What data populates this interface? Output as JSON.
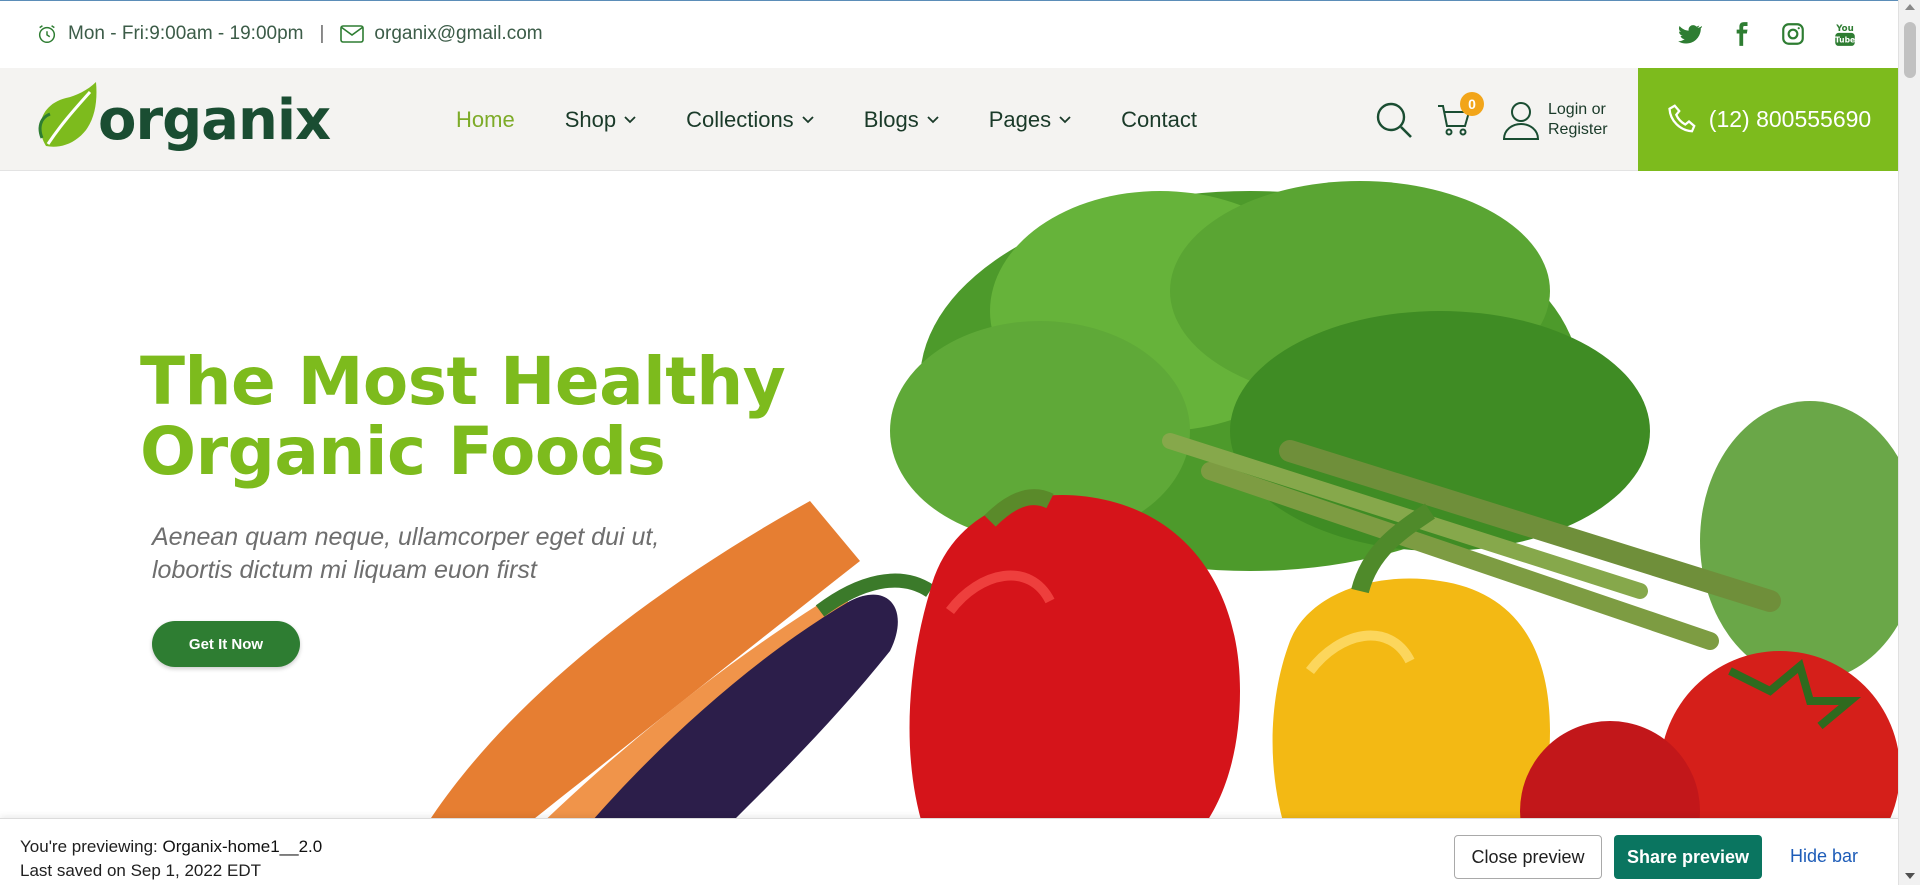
{
  "topbar": {
    "hours": "Mon - Fri:9:00am - 19:00pm",
    "separator": "|",
    "email": "organix@gmail.com",
    "social": [
      "twitter-icon",
      "facebook-icon",
      "instagram-icon",
      "youtube-icon"
    ]
  },
  "header": {
    "logo_text": "organix",
    "nav": [
      {
        "label": "Home",
        "active": true
      },
      {
        "label": "Shop",
        "dropdown": true
      },
      {
        "label": "Collections",
        "dropdown": true
      },
      {
        "label": "Blogs",
        "dropdown": true
      },
      {
        "label": "Pages",
        "dropdown": true
      },
      {
        "label": "Contact"
      }
    ],
    "cart_count": "0",
    "login_line1": "Login or",
    "login_line2": "Register",
    "phone": "(12) 800555690"
  },
  "hero": {
    "title_line1": "The Most Healthy",
    "title_line2": "Organic Foods",
    "subtitle_line1": "Aenean quam neque, ullamcorper eget dui ut,",
    "subtitle_line2": "lobortis dictum mi liquam euon first",
    "cta": "Get It Now"
  },
  "preview_bar": {
    "previewing_label": "You're previewing:",
    "previewing_name": "Organix-home1__2.0",
    "last_saved": "Last saved on Sep 1, 2022 EDT",
    "close": "Close preview",
    "share": "Share preview",
    "hide": "Hide bar"
  },
  "colors": {
    "brand_green": "#7dbb1d",
    "dark_green": "#1a4d32",
    "button_green": "#2e7d32",
    "share_teal": "#0a7560",
    "badge_orange": "#f2a51a"
  }
}
